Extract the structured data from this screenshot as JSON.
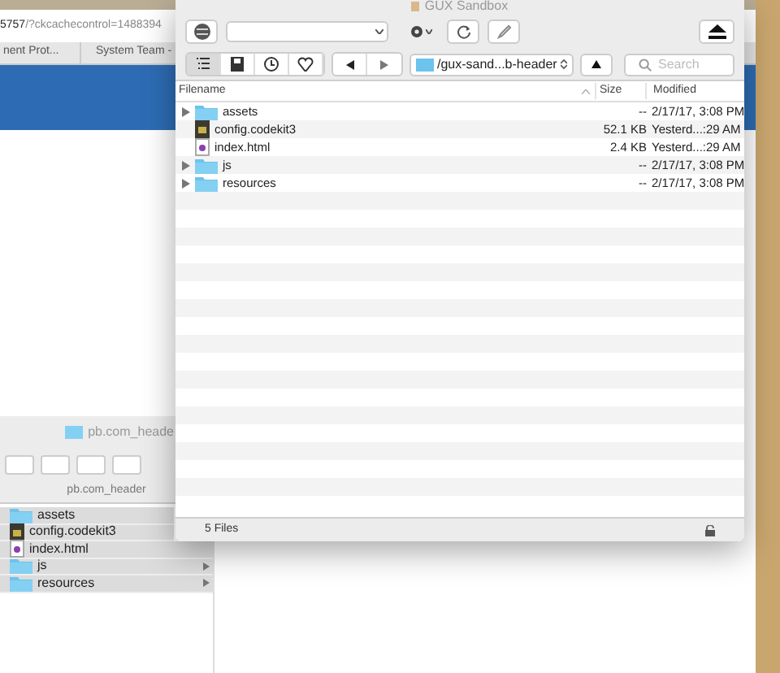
{
  "browser": {
    "url_host": "5757",
    "url_path": "/?ckcachecontrol=1488394",
    "tabs": [
      "nent Prot...",
      "System Team -"
    ]
  },
  "back_window": {
    "title": "pb.com_heade",
    "path_label": "pb.com_header",
    "items": [
      {
        "name": "assets",
        "kind": "folder",
        "expandable": false
      },
      {
        "name": "config.codekit3",
        "kind": "codekit",
        "expandable": false
      },
      {
        "name": "index.html",
        "kind": "html",
        "expandable": false
      },
      {
        "name": "js",
        "kind": "folder",
        "expandable": true
      },
      {
        "name": "resources",
        "kind": "folder",
        "expandable": true
      }
    ]
  },
  "window": {
    "title": "GUX Sandbox",
    "path": "/gux-sand...b-header",
    "search": {
      "placeholder": "Search"
    },
    "view_buttons": [
      {
        "selected": true
      },
      {
        "selected": false
      },
      {
        "selected": false
      },
      {
        "selected": false
      }
    ],
    "columns": [
      "Filename",
      "Size",
      "Modified"
    ],
    "rows": [
      {
        "name": "assets",
        "kind": "folder",
        "expandable": true,
        "size": "--",
        "modified": "2/17/17, 3:08 PM"
      },
      {
        "name": "config.codekit3",
        "kind": "codekit",
        "expandable": false,
        "size": "52.1 KB",
        "modified": "Yesterd...:29 AM"
      },
      {
        "name": "index.html",
        "kind": "html",
        "expandable": false,
        "size": "2.4 KB",
        "modified": "Yesterd...:29 AM"
      },
      {
        "name": "js",
        "kind": "folder",
        "expandable": true,
        "size": "--",
        "modified": "2/17/17, 3:08 PM"
      },
      {
        "name": "resources",
        "kind": "folder",
        "expandable": true,
        "size": "--",
        "modified": "2/17/17, 3:08 PM"
      }
    ],
    "status": "5 Files"
  }
}
